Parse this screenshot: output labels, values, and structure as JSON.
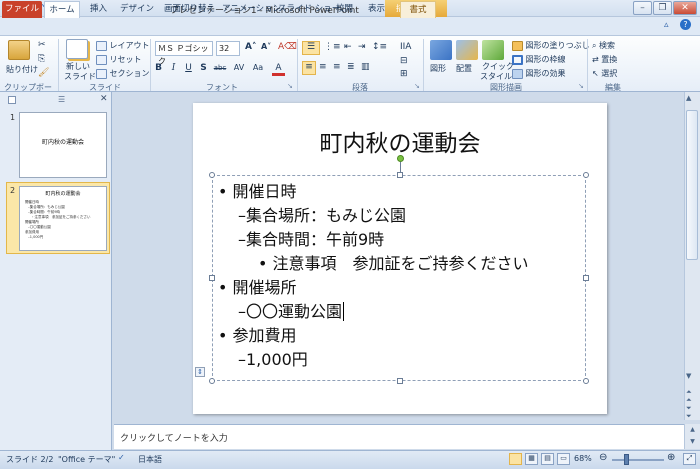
{
  "window": {
    "title": "プレゼンテーション1 - Microsoft PowerPoint",
    "app_letter": "P",
    "contextual_header": "描画ツール"
  },
  "tabs": [
    "ファイル",
    "ホーム",
    "挿入",
    "デザイン",
    "画面切り替え",
    "アニメーション",
    "スライド ショー",
    "校閲",
    "表示",
    "書式"
  ],
  "ribbon": {
    "clipboard": {
      "paste": "貼り付け",
      "label": "クリップボード"
    },
    "slides": {
      "new_slide": "新しい",
      "new_slide2": "スライド",
      "layout": "レイアウト",
      "reset": "リセット",
      "section": "セクション",
      "label": "スライド"
    },
    "font": {
      "name": "ＭＳ Ｐゴシック",
      "size": "32",
      "label": "フォント",
      "buttons": [
        "B",
        "I",
        "U",
        "S",
        "abc",
        "AV",
        "Aa",
        "A"
      ]
    },
    "paragraph": {
      "label": "段落"
    },
    "drawing": {
      "shapes": "図形",
      "arrange": "配置",
      "quick_styles": "クイック",
      "quick_styles2": "スタイル",
      "fill": "図形の塗りつぶし",
      "outline": "図形の枠線",
      "effects": "図形の効果",
      "label": "図形描画"
    },
    "editing": {
      "find": "検索",
      "replace": "置換",
      "select": "選択",
      "label": "編集"
    }
  },
  "thumbnails": [
    {
      "num": "1",
      "title": "町内秋の運動会"
    },
    {
      "num": "2",
      "title": "町内秋の運動会",
      "lines": [
        "開催日時",
        "–集合場所：もみじ公園",
        "–集合時間：午前9時",
        "・注意事項　参加証をご持参ください",
        "開催場所",
        "–〇〇運動公園",
        "参加費用",
        "–1,000円"
      ]
    }
  ],
  "slide": {
    "title": "町内秋の運動会",
    "bullets": [
      {
        "level": 1,
        "marker": "•",
        "text": "開催日時"
      },
      {
        "level": 2,
        "marker": "–",
        "text": "集合場所：もみじ公園"
      },
      {
        "level": 2,
        "marker": "–",
        "text": "集合時間：午前9時"
      },
      {
        "level": 3,
        "marker": "•",
        "text": "注意事項　参加証をご持参ください"
      },
      {
        "level": 1,
        "marker": "•",
        "text": "開催場所"
      },
      {
        "level": 2,
        "marker": "–",
        "text": "〇〇運動公園"
      },
      {
        "level": 1,
        "marker": "•",
        "text": "参加費用"
      },
      {
        "level": 2,
        "marker": "–",
        "text": "1,000円"
      }
    ]
  },
  "notes": {
    "placeholder": "クリックしてノートを入力"
  },
  "status": {
    "slide": "スライド 2/2",
    "theme": "\"Office テーマ\"",
    "language": "日本語",
    "zoom": "68%"
  },
  "colors": {
    "file_tab": "#c9412a",
    "accent": "#2a5ea7",
    "ribbon_bg": "#fdfefe",
    "context": "#e6a93a"
  }
}
